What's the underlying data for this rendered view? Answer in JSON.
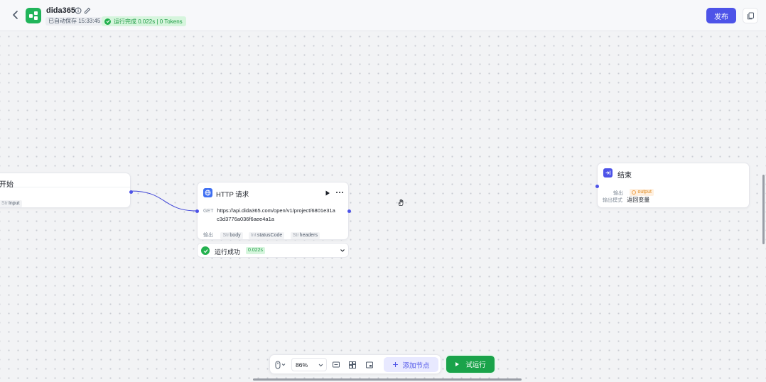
{
  "header": {
    "app_name": "dida365",
    "save_status": "已自动保存 15:33:45",
    "run_status": "运行完成 0.022s | 0 Tokens",
    "publish_label": "发布"
  },
  "canvas": {
    "start_node": {
      "title": "开始",
      "param_tag": "Input"
    },
    "http_node": {
      "title": "HTTP 请求",
      "method": "GET",
      "url_line1": "https://api.dida365.com/open/v1/project/6801e31a",
      "url_line2": "c3d3776a036f6aee4a1a",
      "output_label": "输出",
      "outputs": [
        {
          "type": "Str",
          "name": "body"
        },
        {
          "type": "Int",
          "name": "statusCode"
        },
        {
          "type": "Str",
          "name": "headers"
        }
      ]
    },
    "run_result": {
      "text": "运行成功",
      "time": "0.022s"
    },
    "end_node": {
      "title": "结束",
      "output_label": "输出",
      "output_var": "output",
      "answer_label": "输出模式",
      "answer_value": "返回变量"
    }
  },
  "toolbar": {
    "zoom": "86%",
    "add_node_label": "添加节点",
    "test_run_label": "试运行"
  },
  "colors": {
    "accent": "#4d53e8",
    "success": "#1aa34a",
    "app_icon": "#20b45a",
    "http_icon": "#3f6ff2",
    "edge": "#3f45d8"
  }
}
